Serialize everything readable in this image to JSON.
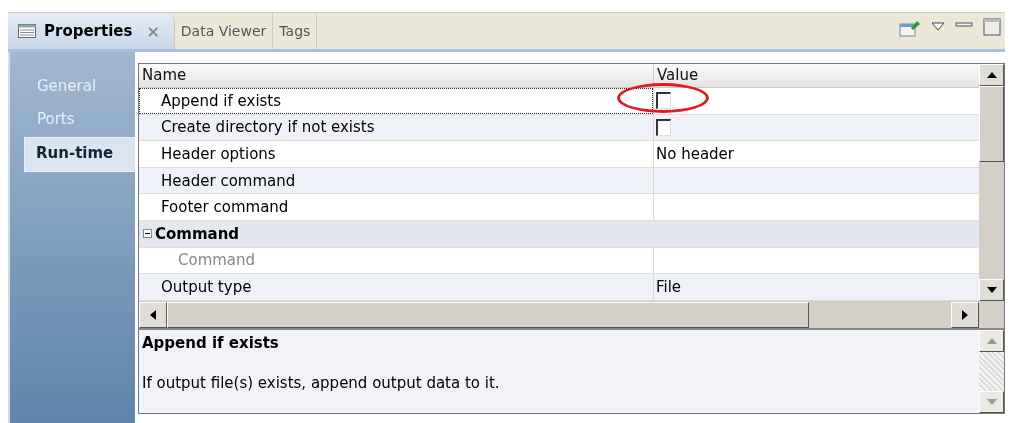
{
  "tabs": [
    {
      "label": "Properties",
      "selected": true,
      "close": "×"
    },
    {
      "label": "Data Viewer",
      "selected": false
    },
    {
      "label": "Tags",
      "selected": false
    }
  ],
  "sidebar": {
    "items": [
      {
        "label": "General",
        "selected": false
      },
      {
        "label": "Ports",
        "selected": false
      },
      {
        "label": "Run-time",
        "selected": true
      }
    ]
  },
  "grid": {
    "columns": [
      "Name",
      "Value"
    ],
    "rows": [
      {
        "kind": "checkbox",
        "name": "Append if exists",
        "checked": false,
        "selected": true,
        "circled": true
      },
      {
        "kind": "checkbox",
        "name": "Create directory if not exists",
        "checked": false,
        "selected": false,
        "circled": false
      },
      {
        "kind": "property",
        "name": "Header options",
        "value": "No header",
        "selected": false
      },
      {
        "kind": "property",
        "name": "Header command",
        "selected": false
      },
      {
        "kind": "property",
        "name": "Footer command",
        "selected": false
      },
      {
        "kind": "group",
        "name": "Command",
        "expanded": true,
        "selected": false,
        "children": [
          {
            "kind": "property",
            "name": "Command",
            "disabled": true,
            "selected": false
          }
        ]
      },
      {
        "kind": "property",
        "name": "Output type",
        "value": "File",
        "selected": false
      }
    ]
  },
  "description": {
    "title": "Append if exists",
    "text": "If output file(s) exists, append output data to it."
  }
}
